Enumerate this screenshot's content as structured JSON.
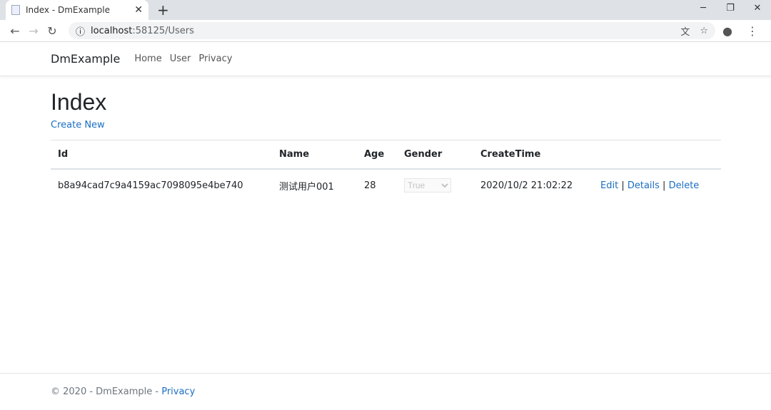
{
  "browser": {
    "tab_title": "Index - DmExample",
    "url_host": "localhost",
    "url_rest": ":58125/Users"
  },
  "navbar": {
    "brand": "DmExample",
    "links": [
      "Home",
      "User",
      "Privacy"
    ]
  },
  "main": {
    "title": "Index",
    "create_new": "Create New",
    "columns": [
      "Id",
      "Name",
      "Age",
      "Gender",
      "CreateTime"
    ],
    "rows": [
      {
        "id": "b8a94cad7c9a4159ac7098095e4be740",
        "name": "测试用户001",
        "age": "28",
        "gender": "True",
        "create_time": "2020/10/2 21:02:22",
        "edit": "Edit",
        "details": "Details",
        "delete": "Delete"
      }
    ]
  },
  "footer": {
    "text": "© 2020 - DmExample - ",
    "privacy": "Privacy"
  }
}
